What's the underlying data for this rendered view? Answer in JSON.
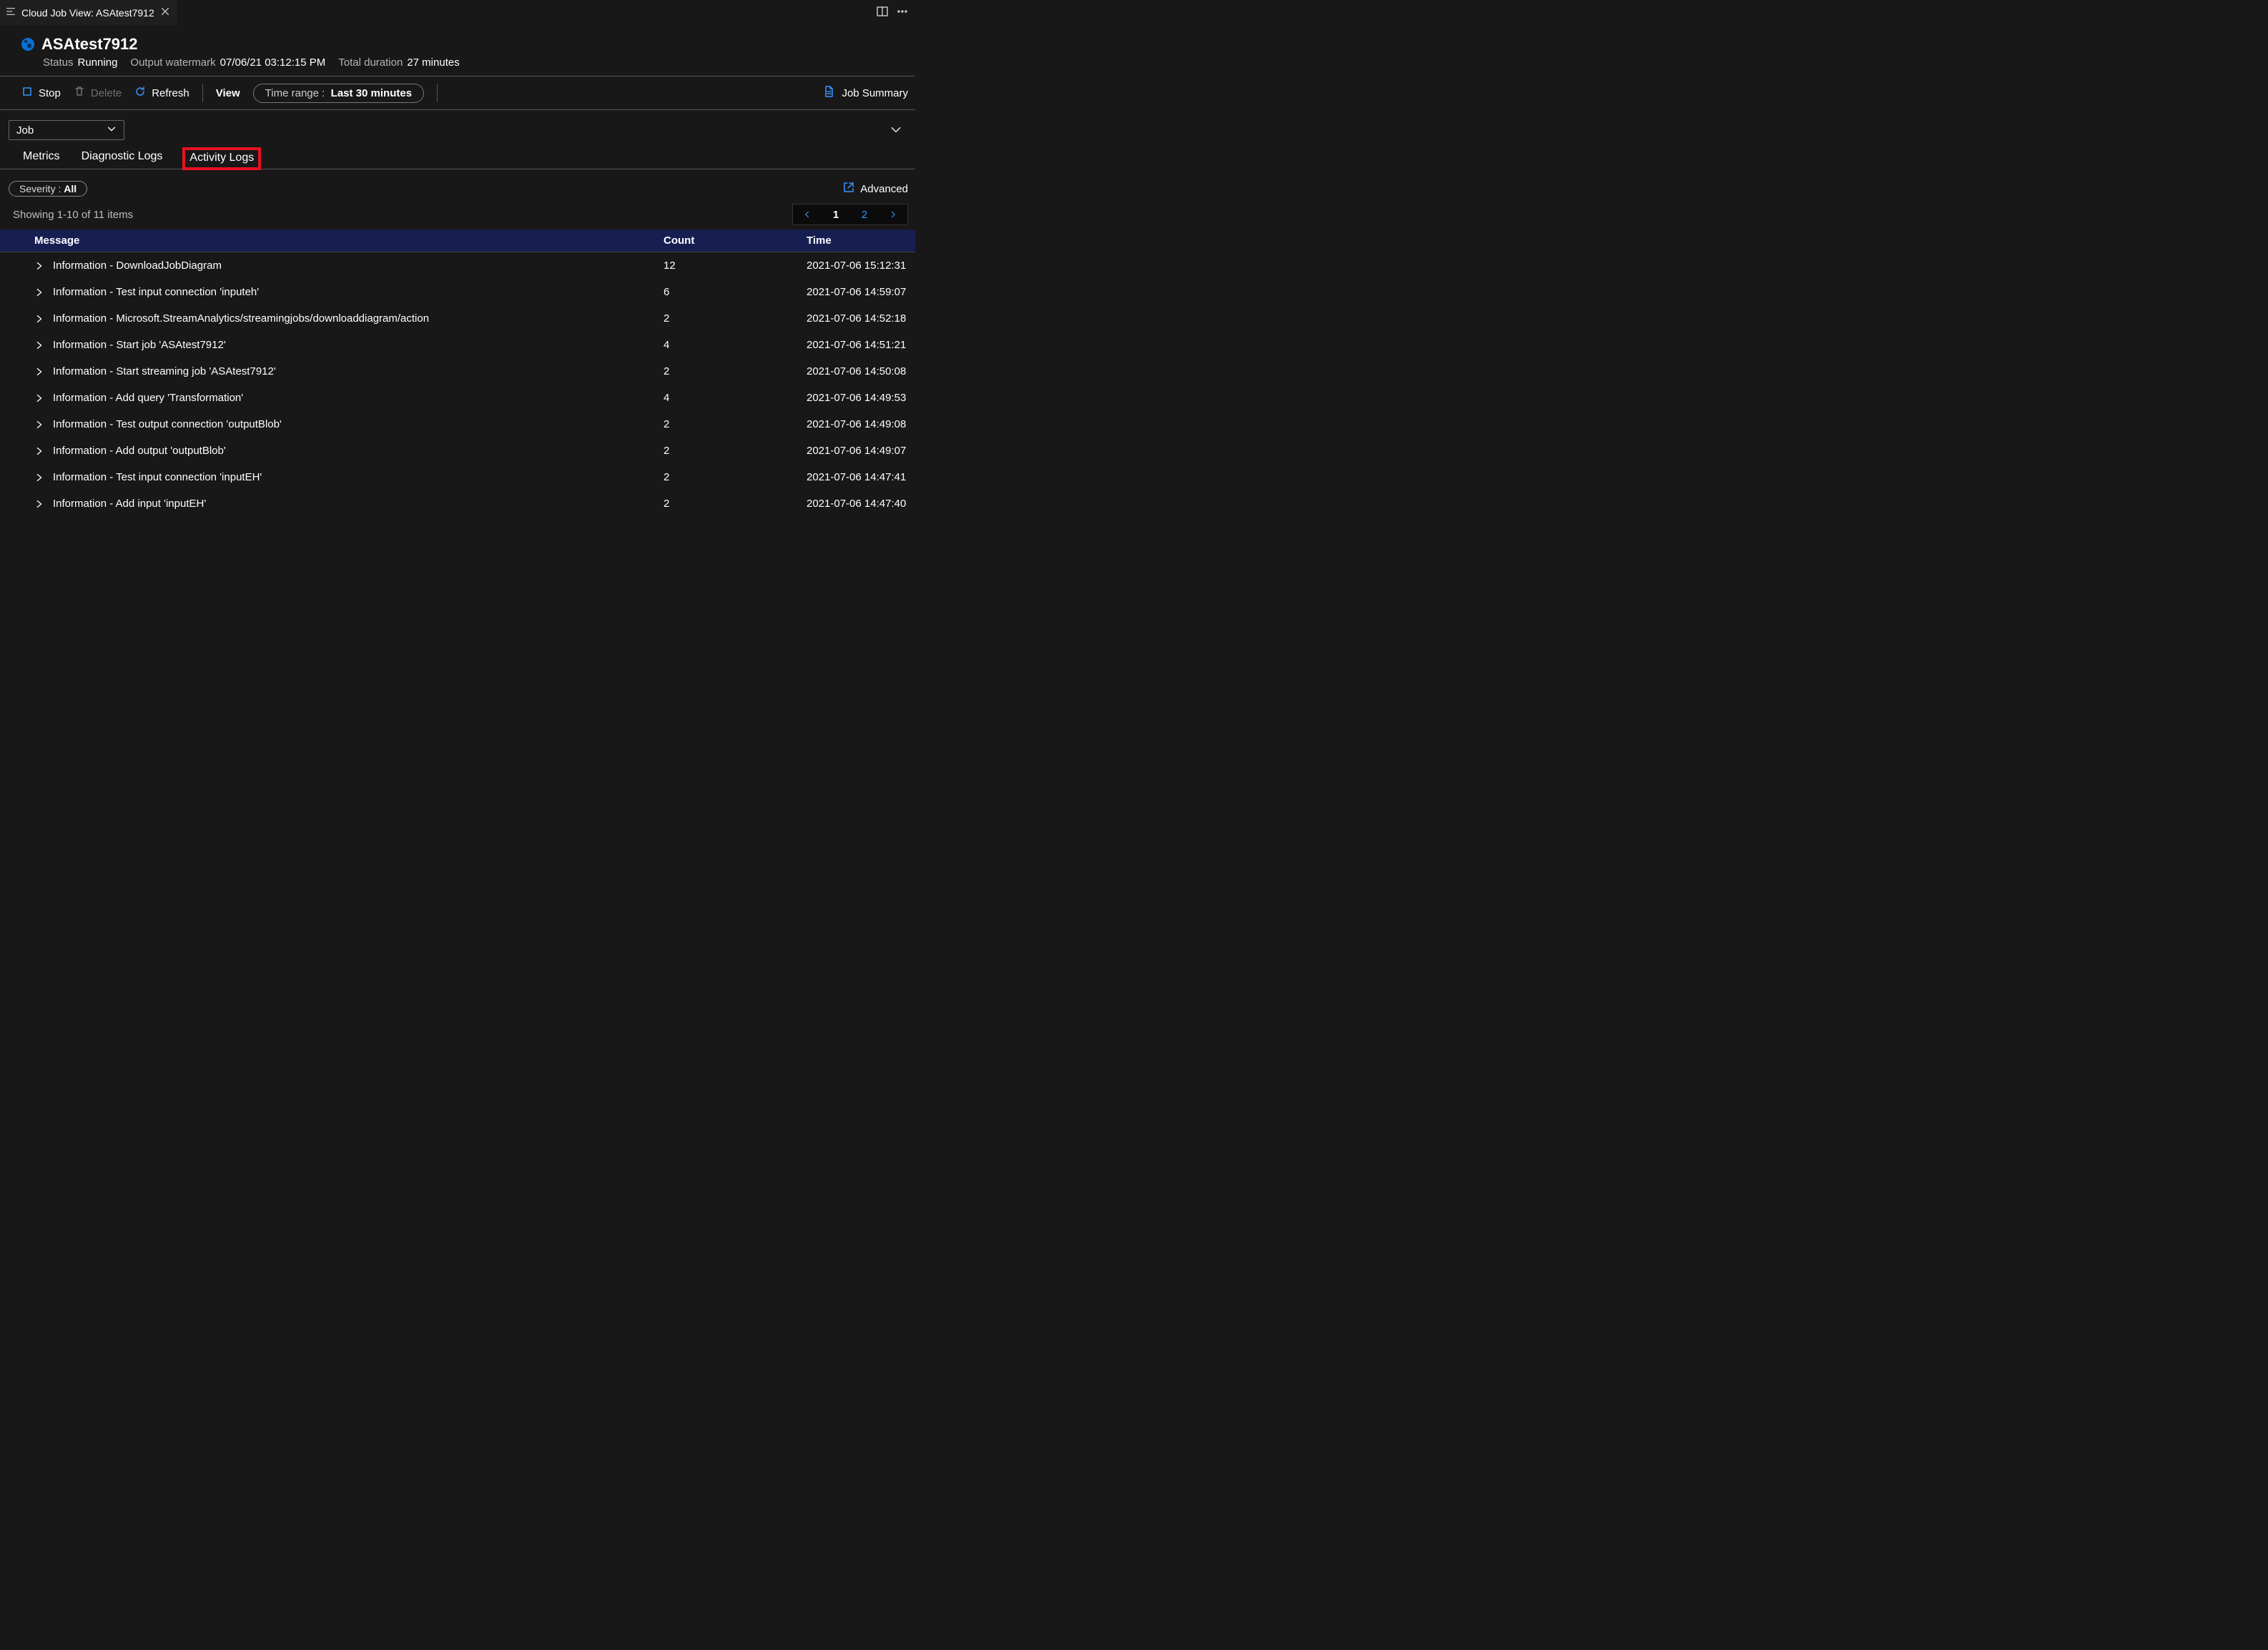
{
  "titlebar": {
    "tab_label": "Cloud Job View: ASAtest7912"
  },
  "header": {
    "job_name": "ASAtest7912",
    "status_label": "Status",
    "status_value": "Running",
    "watermark_label": "Output watermark",
    "watermark_value": "07/06/21 03:12:15 PM",
    "duration_label": "Total duration",
    "duration_value": "27 minutes"
  },
  "toolbar": {
    "stop": "Stop",
    "delete": "Delete",
    "refresh": "Refresh",
    "view": "View",
    "time_range_label": "Time range :",
    "time_range_value": "Last 30 minutes",
    "job_summary": "Job Summary"
  },
  "scope": {
    "selected": "Job"
  },
  "subtabs": {
    "metrics": "Metrics",
    "diagnostic": "Diagnostic Logs",
    "activity": "Activity Logs"
  },
  "filter": {
    "severity_label": "Severity :",
    "severity_value": "All",
    "advanced": "Advanced"
  },
  "list": {
    "showing": "Showing 1-10 of 11 items",
    "pages": {
      "current": "1",
      "other": "2"
    },
    "columns": {
      "message": "Message",
      "count": "Count",
      "time": "Time"
    },
    "rows": [
      {
        "message": "Information - DownloadJobDiagram",
        "count": "12",
        "time": "2021-07-06 15:12:31"
      },
      {
        "message": "Information - Test input connection 'inputeh'",
        "count": "6",
        "time": "2021-07-06 14:59:07"
      },
      {
        "message": "Information - Microsoft.StreamAnalytics/streamingjobs/downloaddiagram/action",
        "count": "2",
        "time": "2021-07-06 14:52:18"
      },
      {
        "message": "Information - Start job 'ASAtest7912'",
        "count": "4",
        "time": "2021-07-06 14:51:21"
      },
      {
        "message": "Information - Start streaming job 'ASAtest7912'",
        "count": "2",
        "time": "2021-07-06 14:50:08"
      },
      {
        "message": "Information - Add query 'Transformation'",
        "count": "4",
        "time": "2021-07-06 14:49:53"
      },
      {
        "message": "Information - Test output connection 'outputBlob'",
        "count": "2",
        "time": "2021-07-06 14:49:08"
      },
      {
        "message": "Information - Add output 'outputBlob'",
        "count": "2",
        "time": "2021-07-06 14:49:07"
      },
      {
        "message": "Information - Test input connection 'inputEH'",
        "count": "2",
        "time": "2021-07-06 14:47:41"
      },
      {
        "message": "Information - Add input 'inputEH'",
        "count": "2",
        "time": "2021-07-06 14:47:40"
      }
    ]
  }
}
